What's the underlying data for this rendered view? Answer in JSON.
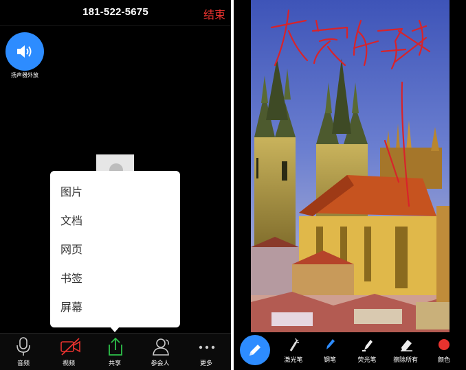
{
  "call_header": {
    "phone_number": "181-522-5675",
    "end_label": "结束"
  },
  "speaker": {
    "label": "扬声器外放",
    "icon": "speaker-icon"
  },
  "share_menu": {
    "items": [
      "图片",
      "文档",
      "网页",
      "书签",
      "屏幕"
    ]
  },
  "bottom_toolbar": {
    "tabs": [
      {
        "label": "音频",
        "icon": "microphone-icon"
      },
      {
        "label": "视频",
        "icon": "video-off-icon",
        "color": "#e8322e"
      },
      {
        "label": "共享",
        "icon": "share-upload-icon",
        "color": "#2ec24a"
      },
      {
        "label": "参会人",
        "icon": "participants-icon"
      },
      {
        "label": "更多",
        "icon": "more-icon"
      }
    ]
  },
  "annotation_toolbar": {
    "active_tool_icon": "pencil-icon",
    "tools": [
      {
        "label": "激光笔",
        "icon": "laser-pointer-icon"
      },
      {
        "label": "钢笔",
        "icon": "pen-icon"
      },
      {
        "label": "荧光笔",
        "icon": "highlighter-icon"
      },
      {
        "label": "擦除所有",
        "icon": "eraser-icon"
      },
      {
        "label": "颜色",
        "icon": "color-dot-icon",
        "color": "#e8322e"
      }
    ]
  },
  "shared_content": {
    "subject": "church-photo",
    "annotation_text": "大家好",
    "annotation_color": "#d8232a"
  },
  "colors": {
    "accent": "#2d8cff",
    "danger": "#e8322e",
    "share_green": "#2ec24a"
  }
}
